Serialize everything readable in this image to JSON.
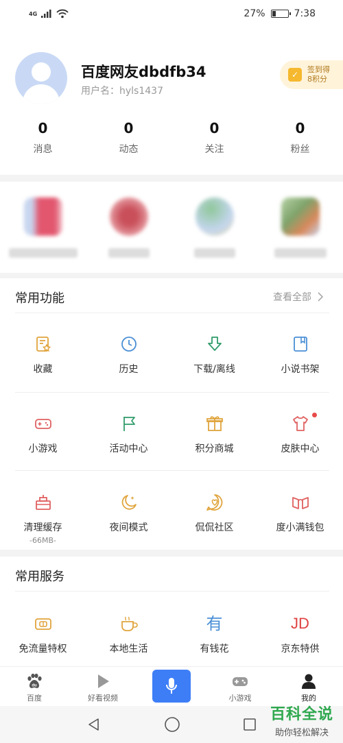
{
  "status_bar": {
    "network": "4G",
    "battery_percent": "27%",
    "battery_level": 0.27,
    "time": "7:38"
  },
  "profile": {
    "nickname": "百度网友dbdfb34",
    "username": "用户名：hyls1437",
    "checkin_line1": "签到得",
    "checkin_line2": "8积分"
  },
  "stats": [
    {
      "value": "0",
      "label": "消息"
    },
    {
      "value": "0",
      "label": "动态"
    },
    {
      "value": "0",
      "label": "关注"
    },
    {
      "value": "0",
      "label": "粉丝"
    }
  ],
  "common_functions": {
    "title": "常用功能",
    "view_all": "查看全部",
    "items": [
      {
        "label": "收藏",
        "icon": "favorites-icon",
        "color": "#e0a43c"
      },
      {
        "label": "历史",
        "icon": "history-clock-icon",
        "color": "#4a8fd6"
      },
      {
        "label": "下载/离线",
        "icon": "download-icon",
        "color": "#2f9b6a"
      },
      {
        "label": "小说书架",
        "icon": "bookshelf-icon",
        "color": "#4a8fd6"
      },
      {
        "label": "小游戏",
        "icon": "gamepad-icon",
        "color": "#e06060"
      },
      {
        "label": "活动中心",
        "icon": "flag-icon",
        "color": "#2f9b6a"
      },
      {
        "label": "积分商城",
        "icon": "gift-icon",
        "color": "#e0a43c"
      },
      {
        "label": "皮肤中心",
        "icon": "shirt-icon",
        "color": "#e06060"
      },
      {
        "label": "清理缓存",
        "sub": "-66MB-",
        "icon": "clean-cache-icon",
        "color": "#e06060"
      },
      {
        "label": "夜间模式",
        "icon": "moon-icon",
        "color": "#e0a43c"
      },
      {
        "label": "侃侃社区",
        "icon": "community-icon",
        "color": "#e0a43c"
      },
      {
        "label": "度小满钱包",
        "icon": "wallet-icon",
        "color": "#e06060"
      }
    ]
  },
  "common_services": {
    "title": "常用服务",
    "items": [
      {
        "label": "免流量特权",
        "icon": "data-free-icon",
        "color": "#e0a43c"
      },
      {
        "label": "本地生活",
        "icon": "coffee-cup-icon",
        "color": "#e0a43c"
      },
      {
        "label": "有钱花",
        "icon": "youqianhua-icon",
        "color": "#4a8fd6",
        "glyph": "有"
      },
      {
        "label": "京东特供",
        "icon": "jd-icon",
        "color": "#e04040",
        "glyph": "JD"
      }
    ]
  },
  "tabbar": [
    {
      "label": "百度",
      "icon": "baidu-paw-icon"
    },
    {
      "label": "好看视频",
      "icon": "play-icon"
    },
    {
      "label": "",
      "icon": "microphone-icon"
    },
    {
      "label": "小游戏",
      "icon": "gamepad-icon"
    },
    {
      "label": "我的",
      "icon": "person-icon"
    }
  ],
  "watermark": {
    "title": "百科全说",
    "subtitle": "助你轻松解决"
  }
}
